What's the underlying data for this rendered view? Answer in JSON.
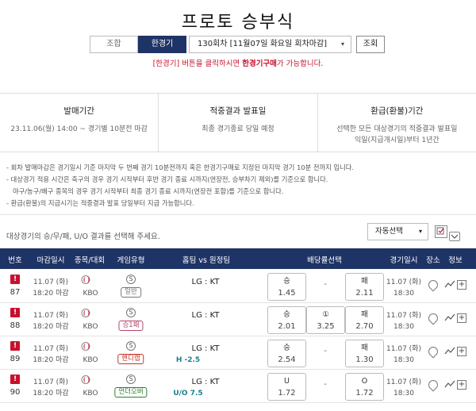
{
  "page_title": "프로토 승부식",
  "tabs": [
    {
      "label": "조합",
      "active": false
    },
    {
      "label": "한경기",
      "active": true
    }
  ],
  "round_select": {
    "value": "130회차 [11월07일 화요일 회차마감]",
    "caret": "▾"
  },
  "lookup_button": "조회",
  "notice": {
    "part1": "[한경기] 버튼을 클릭하시면 ",
    "highlight": "한경기구매",
    "part2": "가 가능합니다."
  },
  "info": [
    {
      "heading": "발매기간",
      "text1": "23.11.06(월) 14:00 ~ 경기별 10분전 마감",
      "text2": ""
    },
    {
      "heading": "적중결과 발표일",
      "text1": "최종 경기종료 당일 예정",
      "text2": ""
    },
    {
      "heading": "환급(환불)기간",
      "text1": "선택한 모든 대상경기의 적중결과 발표일",
      "text2": "익일(지급개시일)부터 1년간"
    }
  ],
  "guide": [
    "- 회차 발매마감은 경기일시 기준 마지막 두 번째 경기 10분전까지 혹은 한경기구매로 지정된 마지막 경기 10분 전까지 입니다.",
    "- 대상경기 적용 시간은 축구의 경우 경기 시작부터 후반 경기 종료 시까지(연장전, 승부차기 제외)를 기준으로 합니다.",
    "  야구/농구/배구 종목의 경우 경기 시작부터 최종 경기 종료 시까지(연장전 포함)를 기준으로 합니다.",
    "- 환급(환불)의 지급시기는 적중결과 발표 당일부터 지급 가능합니다."
  ],
  "instruction": "대상경기의 승/무/패, U/O 결과를 선택해 주세요.",
  "auto_select": {
    "value": "자동선택",
    "caret": "▾"
  },
  "table_headers": {
    "no": "번호",
    "deadline": "마감일시",
    "league": "종목/대회",
    "game_type": "게임유형",
    "matchup": "홈팀 vs 원정팀",
    "odds": "배당률선택",
    "game_time": "경기일시",
    "venue": "장소",
    "info": "정보"
  },
  "rows": [
    {
      "no": "87",
      "deadline_date": "11.07 (화)",
      "deadline_time": "18:20 마감",
      "league": "KBO",
      "game_type": "일반",
      "type_color": "#777777",
      "match": "LG : KT",
      "sub": "",
      "odd1_label": "승",
      "odd1_value": "1.45",
      "mid_label": "",
      "mid_value": "",
      "dash": "-",
      "odd3_label": "패",
      "odd3_value": "2.11",
      "game_date": "11.07 (화)",
      "game_time": "18:30"
    },
    {
      "no": "88",
      "deadline_date": "11.07 (화)",
      "deadline_time": "18:20 마감",
      "league": "KBO",
      "game_type": "승1패",
      "type_color": "#b5466b",
      "match": "LG : KT",
      "sub": "",
      "odd1_label": "승",
      "odd1_value": "2.01",
      "mid_label": "①",
      "mid_value": "3.25",
      "dash": "",
      "odd3_label": "패",
      "odd3_value": "2.70",
      "game_date": "11.07 (화)",
      "game_time": "18:30"
    },
    {
      "no": "89",
      "deadline_date": "11.07 (화)",
      "deadline_time": "18:20 마감",
      "league": "KBO",
      "game_type": "핸디캡",
      "type_color": "#c0392b",
      "match": "LG : KT",
      "sub": "H -2.5",
      "odd1_label": "승",
      "odd1_value": "2.54",
      "mid_label": "",
      "mid_value": "",
      "dash": "-",
      "odd3_label": "패",
      "odd3_value": "1.30",
      "game_date": "11.07 (화)",
      "game_time": "18:30"
    },
    {
      "no": "90",
      "deadline_date": "11.07 (화)",
      "deadline_time": "18:20 마감",
      "league": "KBO",
      "game_type": "언더오버",
      "type_color": "#2e7d32",
      "match": "LG : KT",
      "sub": "U/O 7.5",
      "odd1_label": "U",
      "odd1_value": "1.72",
      "mid_label": "",
      "mid_value": "",
      "dash": "-",
      "odd3_label": "O",
      "odd3_value": "1.72",
      "game_date": "11.07 (화)",
      "game_time": "18:30"
    }
  ],
  "alert_mark": "!",
  "sport_icon": "baseball-icon",
  "s_mark": "S",
  "plus_mark": "+",
  "colors": {
    "navy": "#1f3466",
    "red": "#c8102e",
    "teal": "#1a7f8e"
  }
}
